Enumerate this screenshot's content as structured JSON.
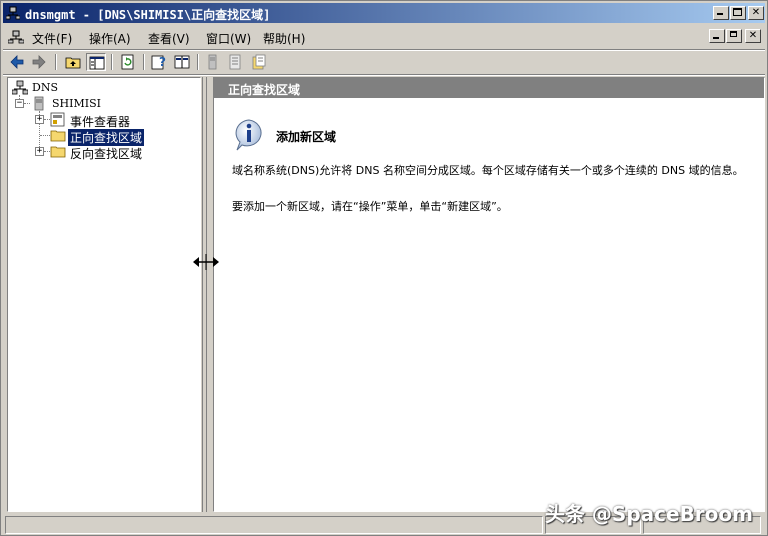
{
  "window": {
    "title": "dnsmgmt - [DNS\\SHIMISI\\正向查找区域]",
    "caption_buttons": [
      "minimize",
      "maximize",
      "close"
    ]
  },
  "menubar": {
    "items": [
      "文件(F)",
      "操作(A)",
      "查看(V)",
      "窗口(W)",
      "帮助(H)"
    ],
    "mdi_buttons": [
      "minimize",
      "restore",
      "close"
    ]
  },
  "toolbar": {
    "buttons": [
      "back-icon",
      "forward-icon",
      "up-icon",
      "show-tree-icon",
      "refresh-icon",
      "help-icon",
      "console-icon",
      "server-icon",
      "list-icon",
      "properties-icon"
    ]
  },
  "tree": {
    "root": "DNS",
    "server": "SHIMISI",
    "children": [
      "事件查看器",
      "正向查找区域",
      "反向查找区域"
    ],
    "selected_index": 1
  },
  "right_pane": {
    "header": "正向查找区域",
    "heading": "添加新区域",
    "paragraph1": "域名称系统(DNS)允许将 DNS 名称空间分成区域。每个区域存储有关一个或多个连续的 DNS 域的信息。",
    "paragraph2": "要添加一个新区域，请在“操作”菜单，单击“新建区域”。"
  },
  "watermark": "头条 @SpaceBroom",
  "colors": {
    "title_gradient_start": "#0a246a",
    "title_gradient_end": "#a6caf0",
    "face": "#d4d0c8",
    "header_gray": "#808080",
    "selection": "#0a246a"
  }
}
